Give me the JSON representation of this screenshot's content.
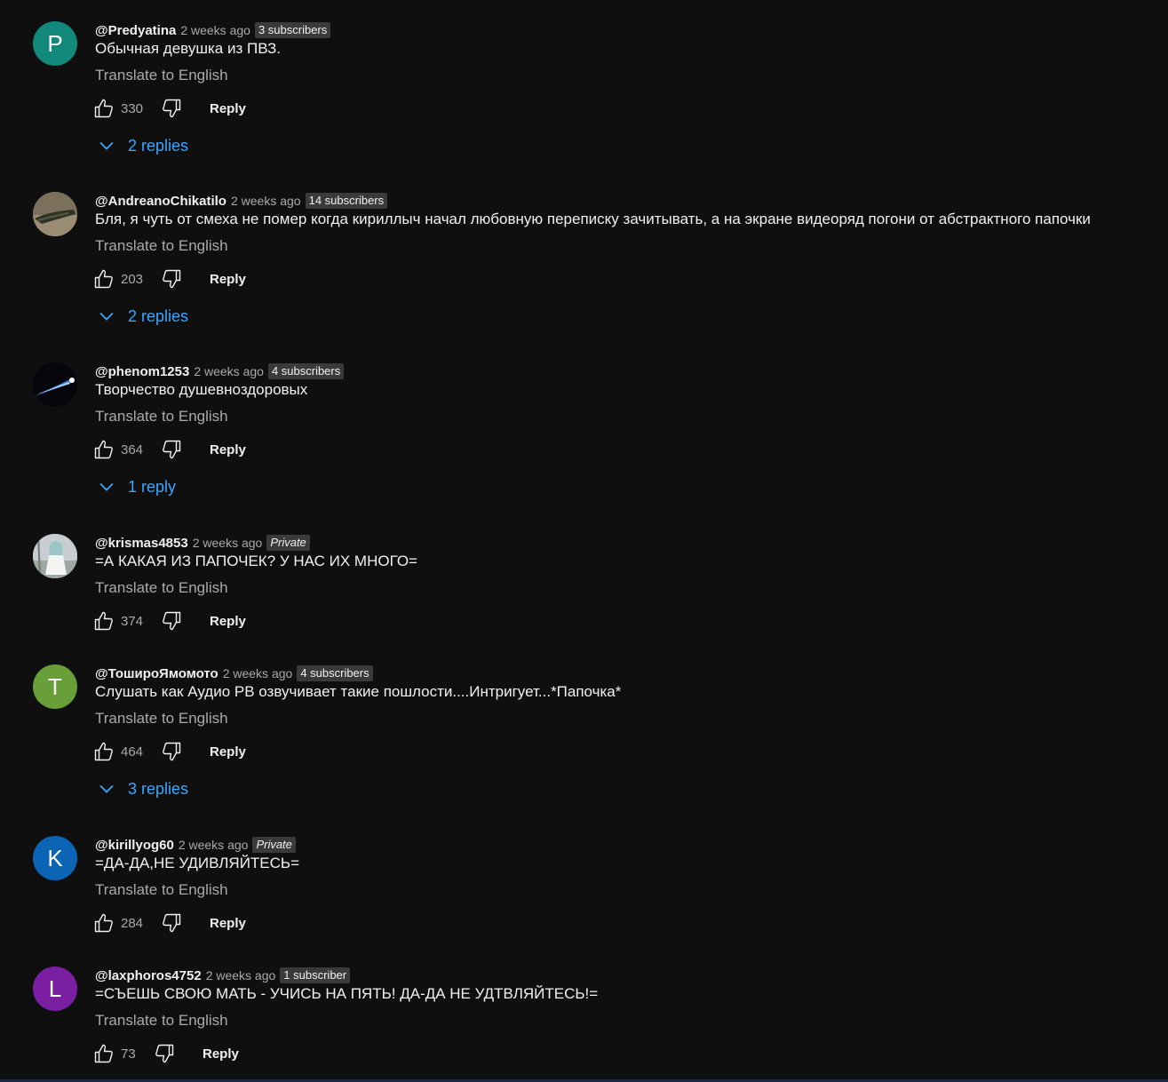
{
  "icons": {
    "like": "thumbs-up-icon",
    "dislike": "thumbs-down-icon",
    "replies": "chevron-down-icon"
  },
  "colors": {
    "background": "#0f0f0f",
    "link_blue": "#3ea6ff",
    "muted_text": "#aaaaaa",
    "badge_bg": "#3a3a3a"
  },
  "comments": [
    {
      "avatar": {
        "letter": "P",
        "color": "#12897b",
        "kind": "letter"
      },
      "author": "@Predyatina",
      "time": "2 weeks ago",
      "badge": "3 subscribers",
      "text": "Обычная девушка из ПВЗ.",
      "translate": "Translate to English",
      "likes": "330",
      "reply_label": "Reply",
      "replies": "2 replies"
    },
    {
      "avatar": {
        "letter": "",
        "color": "#6d6552",
        "kind": "photo-crocodile"
      },
      "author": "@AndreanoChikatilo",
      "time": "2 weeks ago",
      "badge": "14 subscribers",
      "text": "Бля, я чуть от смеха не помер когда кириллыч начал любовную переписку зачитывать, а на экране видеоряд погони от абстрактного папочки",
      "translate": "Translate to English",
      "likes": "203",
      "reply_label": "Reply",
      "replies": "2 replies"
    },
    {
      "avatar": {
        "letter": "",
        "color": "#0a0a12",
        "kind": "photo-comet"
      },
      "author": "@phenom1253",
      "time": "2 weeks ago",
      "badge": "4 subscribers",
      "text": "Творчество душевноздоровых",
      "translate": "Translate to English",
      "likes": "364",
      "reply_label": "Reply",
      "replies": "1 reply"
    },
    {
      "avatar": {
        "letter": "",
        "color": "#c9cfd3",
        "kind": "photo-figure"
      },
      "author": "@krismas4853",
      "time": "2 weeks ago",
      "badge": "Private",
      "text": "=А КАКАЯ ИЗ ПАПОЧЕК? У НАС ИХ МНОГО=",
      "translate": "Translate to English",
      "likes": "374",
      "reply_label": "Reply",
      "replies": ""
    },
    {
      "avatar": {
        "letter": "T",
        "color": "#689f38",
        "kind": "letter"
      },
      "author": "@ТошироЯмомото",
      "time": "2 weeks ago",
      "badge": "4 subscribers",
      "text": "Слушать как Аудио РВ озвучивает такие пошлости....Интригует...*Папочка*",
      "translate": "Translate to English",
      "likes": "464",
      "reply_label": "Reply",
      "replies": "3 replies"
    },
    {
      "avatar": {
        "letter": "K",
        "color": "#0c64b5",
        "kind": "letter"
      },
      "author": "@kirillyog60",
      "time": "2 weeks ago",
      "badge": "Private",
      "text": "=ДА-ДА,НЕ УДИВЛЯЙТЕСЬ=",
      "translate": "Translate to English",
      "likes": "284",
      "reply_label": "Reply",
      "replies": ""
    },
    {
      "avatar": {
        "letter": "L",
        "color": "#7b1fa2",
        "kind": "letter"
      },
      "author": "@laxphoros4752",
      "time": "2 weeks ago",
      "badge": "1 subscriber",
      "text": "=СЪЕШЬ СВОЮ МАТЬ - УЧИСЬ НА ПЯТЬ! ДА-ДА НЕ УДТВЛЯЙТЕСЬ!=",
      "translate": "Translate to English",
      "likes": "73",
      "reply_label": "Reply",
      "replies": ""
    }
  ]
}
